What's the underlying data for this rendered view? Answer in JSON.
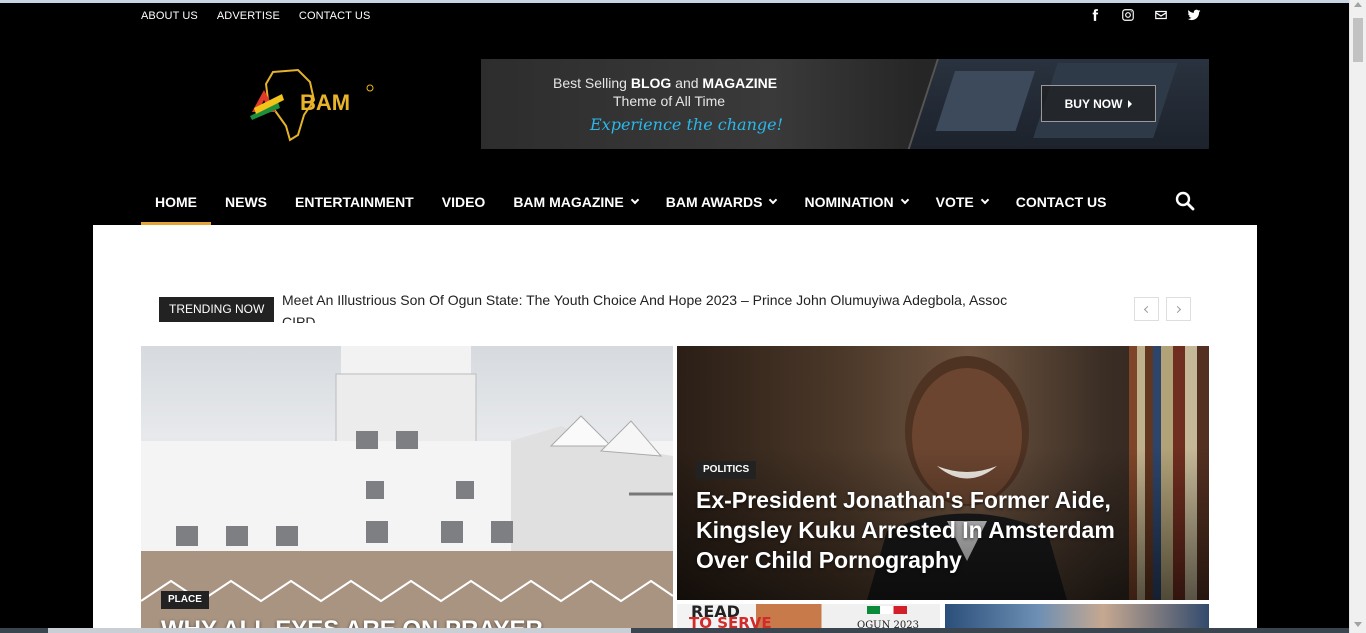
{
  "topbar": {
    "links": [
      "ABOUT US",
      "ADVERTISE",
      "CONTACT US"
    ],
    "social": [
      "facebook-icon",
      "instagram-icon",
      "mail-icon",
      "twitter-icon"
    ]
  },
  "logo": {
    "text": "BAM"
  },
  "banner": {
    "line1_pre": "Best Selling ",
    "line1_b1": "BLOG",
    "line1_mid": " and ",
    "line1_b2": "MAGAZINE",
    "line2": "Theme of All Time",
    "line3": "Experience the change!",
    "cta": "BUY NOW"
  },
  "nav": {
    "items": [
      {
        "label": "HOME",
        "active": true,
        "dropdown": false
      },
      {
        "label": "NEWS",
        "active": false,
        "dropdown": false
      },
      {
        "label": "ENTERTAINMENT",
        "active": false,
        "dropdown": false
      },
      {
        "label": "VIDEO",
        "active": false,
        "dropdown": false
      },
      {
        "label": "BAM MAGAZINE",
        "active": false,
        "dropdown": true
      },
      {
        "label": "BAM AWARDS",
        "active": false,
        "dropdown": true
      },
      {
        "label": "NOMINATION",
        "active": false,
        "dropdown": true
      },
      {
        "label": "VOTE",
        "active": false,
        "dropdown": true
      },
      {
        "label": "CONTACT US",
        "active": false,
        "dropdown": false
      }
    ],
    "search_icon": "search-icon",
    "accent": "#e8a23a"
  },
  "trending": {
    "label": "TRENDING NOW",
    "line1": "Meet An Illustrious Son Of Ogun State: The Youth Choice And Hope 2023 – Prince John Olumuyiwa Adegbola, Assoc",
    "line2": "CIPD"
  },
  "articles": {
    "left": {
      "category": "PLACE",
      "title": "WHY ALL EYES ARE ON PRAYER"
    },
    "right": {
      "category": "POLITICS",
      "title": "Ex-President Jonathan's Former Aide, Kingsley Kuku Arrested In Amsterdam Over Child Pornography"
    },
    "thumb1": {
      "read": "READ",
      "to_serve": "TO SERVE",
      "ogun": "OGUN 2023"
    }
  }
}
